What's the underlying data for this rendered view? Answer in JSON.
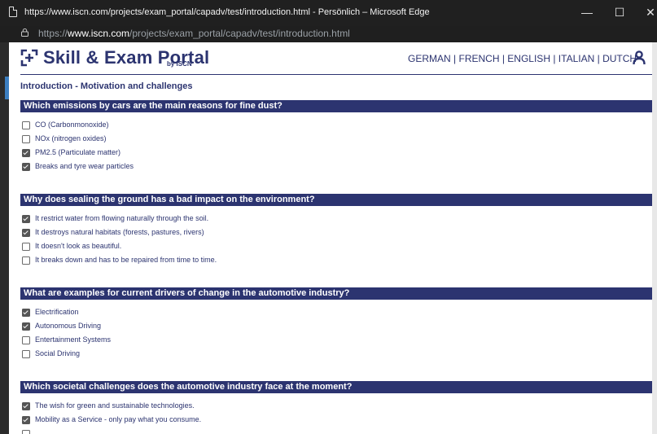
{
  "window": {
    "title": "https://www.iscn.com/projects/exam_portal/capadv/test/introduction.html - Persönlich – Microsoft Edge",
    "url_prefix": "https://",
    "url_domain": "www.iscn.com",
    "url_path": "/projects/exam_portal/capadv/test/introduction.html",
    "minimize_glyph": "—",
    "maximize_glyph": "☐",
    "close_glyph": "✕"
  },
  "header": {
    "logo_name": "Skill & Exam Portal",
    "logo_by": "by ISCN",
    "languages": [
      "GERMAN",
      "FRENCH",
      "ENGLISH",
      "ITALIAN",
      "DUTCH"
    ],
    "separator": "|"
  },
  "page": {
    "intro_title": "Introduction - Motivation and challenges"
  },
  "questions": [
    {
      "text": "Which emissions by cars are the main reasons for fine dust?",
      "options": [
        {
          "label": "CO (Carbonmonoxide)",
          "checked": false
        },
        {
          "label": "NOx (nitrogen oxides)",
          "checked": false
        },
        {
          "label": "PM2.5 (Particulate matter)",
          "checked": true
        },
        {
          "label": "Breaks and tyre wear particles",
          "checked": true
        }
      ]
    },
    {
      "text": "Why does sealing the ground has a bad impact on the environment?",
      "options": [
        {
          "label": "It restrict water from flowing naturally through the soil.",
          "checked": true
        },
        {
          "label": "It destroys natural habitats (forests, pastures, rivers)",
          "checked": true
        },
        {
          "label": "It doesn't look as beautiful.",
          "checked": false
        },
        {
          "label": "It breaks down and has to be repaired from time to time.",
          "checked": false
        }
      ]
    },
    {
      "text": "What are examples for current drivers of change in the automotive industry?",
      "options": [
        {
          "label": "Electrification",
          "checked": true
        },
        {
          "label": "Autonomous Driving",
          "checked": true
        },
        {
          "label": "Entertainment Systems",
          "checked": false
        },
        {
          "label": "Social Driving",
          "checked": false
        }
      ]
    },
    {
      "text": "Which societal challenges does the automotive industry face at the moment?",
      "options": [
        {
          "label": "The wish for green and sustainable technologies.",
          "checked": true
        },
        {
          "label": "Mobility as a Service - only pay what you consume.",
          "checked": true
        }
      ]
    }
  ],
  "colors": {
    "brand_navy": "#2c3470",
    "checkbox_checked": "#555555"
  },
  "icons": [
    "page-icon",
    "lock-icon",
    "iscn-logo-icon",
    "user-icon",
    "checkbox-icon"
  ]
}
